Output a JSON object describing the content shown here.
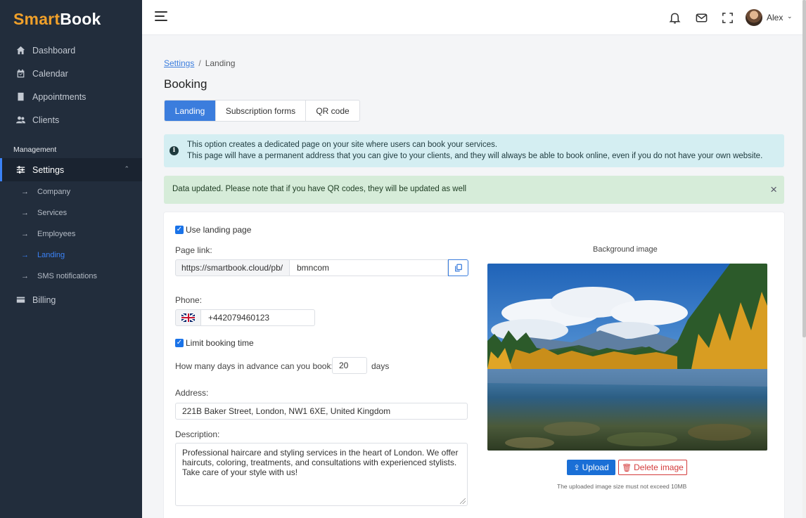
{
  "brand": {
    "part1": "Smart",
    "part2": "Book"
  },
  "sidebar": {
    "items": [
      {
        "label": "Dashboard",
        "icon": "home-icon"
      },
      {
        "label": "Calendar",
        "icon": "calendar-icon"
      },
      {
        "label": "Appointments",
        "icon": "book-icon"
      },
      {
        "label": "Clients",
        "icon": "users-icon"
      }
    ],
    "section": "Management",
    "settings": {
      "label": "Settings",
      "icon": "sliders-icon"
    },
    "sub_items": [
      "Company",
      "Services",
      "Employees",
      "Landing",
      "SMS notifications"
    ],
    "active_sub": "Landing",
    "billing": {
      "label": "Billing",
      "icon": "card-icon"
    }
  },
  "topbar": {
    "user": "Alex"
  },
  "breadcrumb": {
    "parent": "Settings",
    "current": "Landing"
  },
  "page_title": "Booking",
  "tabs": [
    "Landing",
    "Subscription forms",
    "QR code"
  ],
  "info_alert": {
    "icon": "i",
    "line1": "This option creates a dedicated page on your site where users can book your services.",
    "line2": "This page will have a permanent address that you can give to your clients, and they will always be able to book online, even if you do not have your own website."
  },
  "success_alert": {
    "text": "Data updated. Please note that if you have QR codes, they will be updated as well",
    "close": "×"
  },
  "form": {
    "use_landing": {
      "label": "Use landing page",
      "checked": true
    },
    "page_link": {
      "label": "Page link:",
      "prefix": "https://smartbook.cloud/pb/",
      "value": "bmncom"
    },
    "phone": {
      "label": "Phone:",
      "value": "+442079460123",
      "country": "uk-flag-icon"
    },
    "limit_booking": {
      "label": "Limit booking time",
      "checked": true
    },
    "advance": {
      "label": "How many days in advance can you book:",
      "value": "20",
      "unit": "days"
    },
    "address": {
      "label": "Address:",
      "value": "221B Baker Street, London, NW1 6XE, United Kingdom"
    },
    "description": {
      "label": "Description:",
      "value": "Professional haircare and styling services in the heart of London. We offer haircuts, coloring, treatments, and consultations with experienced stylists. Take care of your style with us!"
    }
  },
  "background": {
    "label": "Background image",
    "upload": "Upload",
    "delete": "Delete image",
    "hint": "The uploaded image size must not exceed 10MB"
  },
  "colors": {
    "sidebar": "#222d3c",
    "accent": "#3b7ddd",
    "brand_orange": "#f0a02a",
    "danger": "#d43c3c"
  }
}
